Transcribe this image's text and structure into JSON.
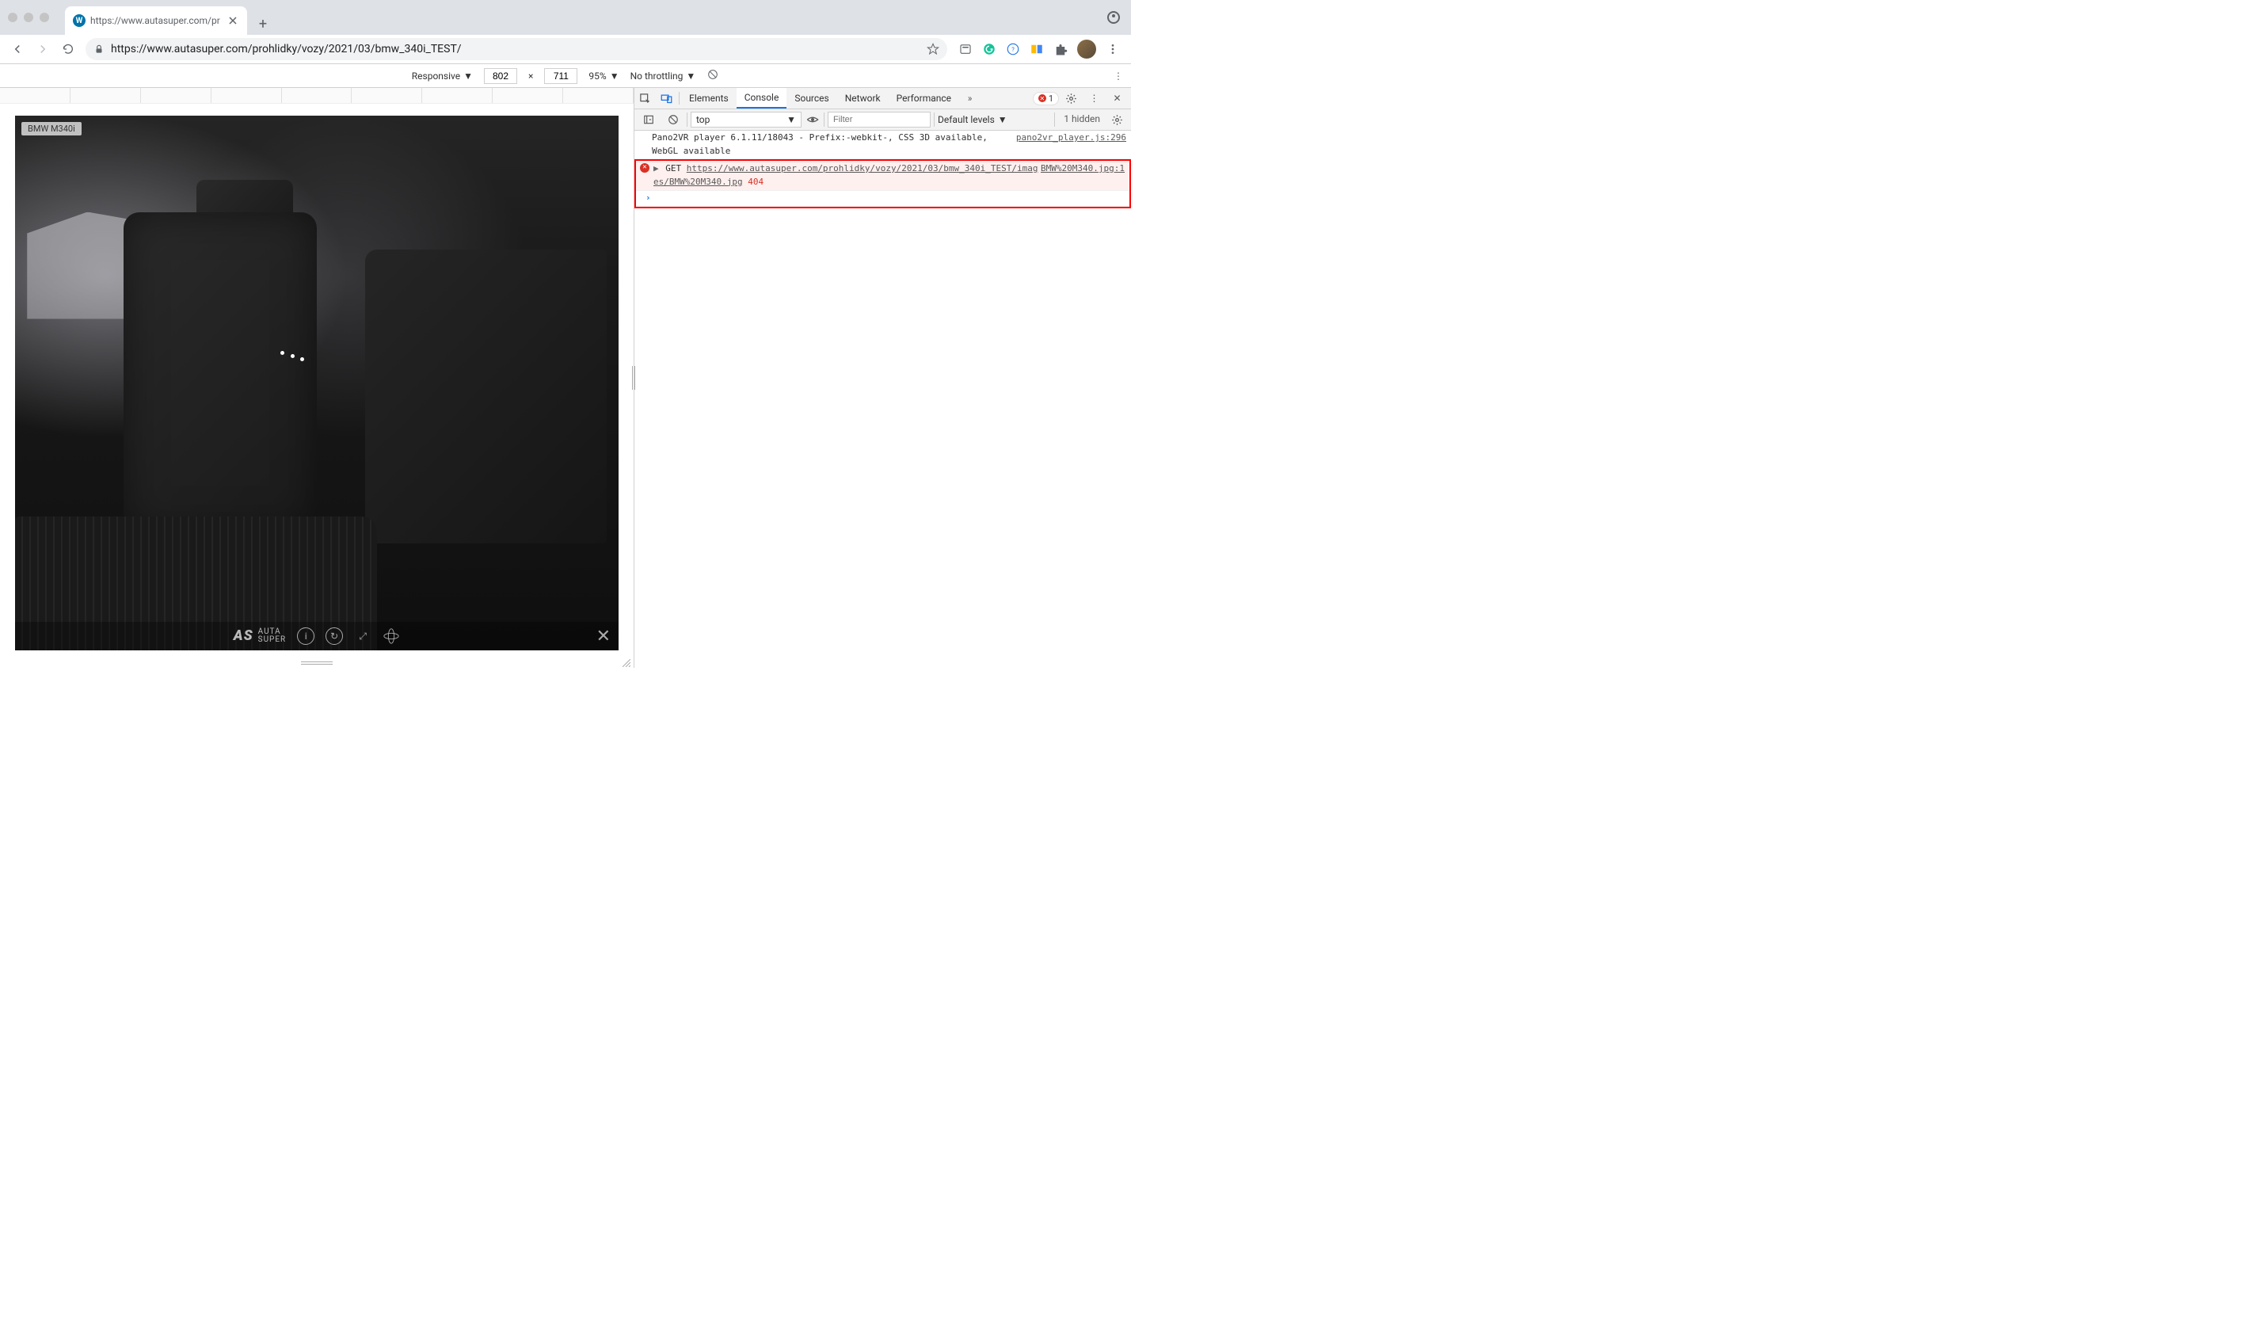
{
  "browser": {
    "tab_title": "https://www.autasuper.com/pr",
    "url": "https://www.autasuper.com/prohlidky/vozy/2021/03/bmw_340i_TEST/"
  },
  "device_toolbar": {
    "mode": "Responsive",
    "width": "802",
    "height": "711",
    "zoom": "95%",
    "throttling": "No throttling"
  },
  "viewport": {
    "badge_label": "BMW M340i",
    "logo_line1": "AUTA",
    "logo_line2": "SUPER"
  },
  "devtools": {
    "tabs": {
      "elements": "Elements",
      "console": "Console",
      "sources": "Sources",
      "network": "Network",
      "performance": "Performance"
    },
    "error_count": "1",
    "filter": {
      "context": "top",
      "placeholder": "Filter",
      "levels": "Default levels",
      "hidden": "1 hidden"
    },
    "console": {
      "info_line": "Pano2VR player 6.1.11/18043 - Prefix:-webkit-, CSS 3D available, WebGL available",
      "info_src": "pano2vr_player.js:296",
      "error_method": "GET",
      "error_url": "https://www.autasuper.com/prohlidky/vozy/2021/03/bmw_340i_TEST/images/BMW%20M340.jpg",
      "error_status": "404",
      "error_src": "BMW%20M340.jpg:1"
    }
  }
}
